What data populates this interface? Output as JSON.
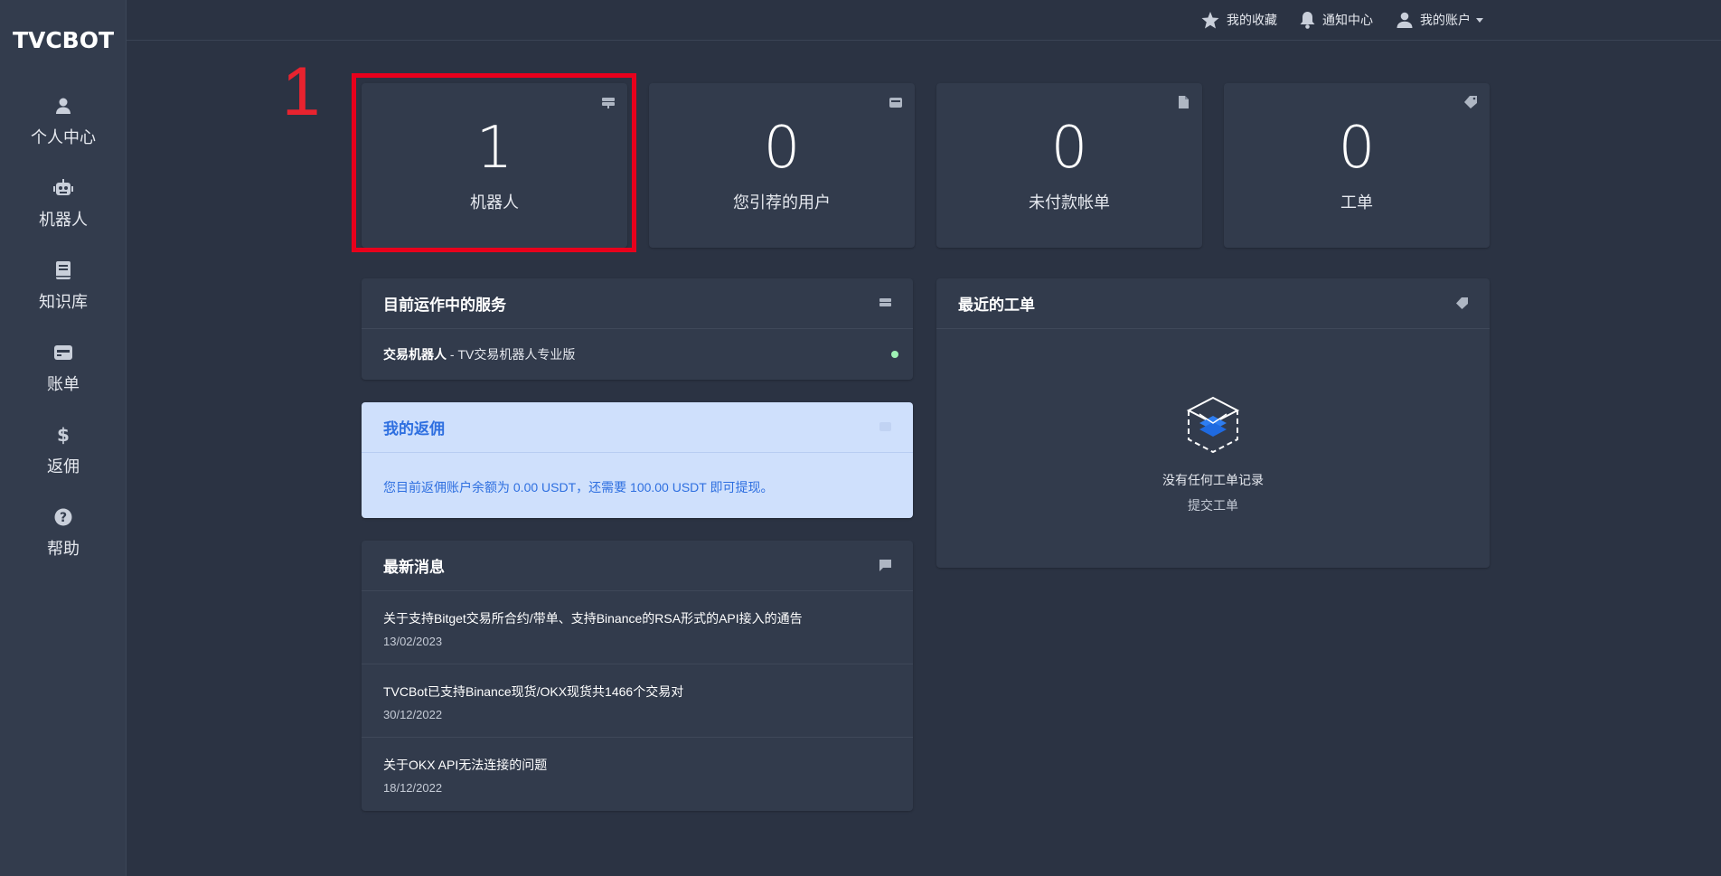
{
  "brand": {
    "logo_text": "TVCBOT"
  },
  "sidebar": {
    "items": [
      {
        "label": "个人中心",
        "icon": "user-icon"
      },
      {
        "label": "机器人",
        "icon": "robot-icon"
      },
      {
        "label": "知识库",
        "icon": "book-icon"
      },
      {
        "label": "账单",
        "icon": "wallet-icon"
      },
      {
        "label": "返佣",
        "icon": "dollar-icon"
      },
      {
        "label": "帮助",
        "icon": "question-icon"
      }
    ]
  },
  "topbar": {
    "favorites": "我的收藏",
    "notifications": "通知中心",
    "account": "我的账户"
  },
  "annotation": {
    "step_number": "1"
  },
  "stats": [
    {
      "value": "1",
      "label": "机器人",
      "icon": "server-icon"
    },
    {
      "value": "0",
      "label": "您引荐的用户",
      "icon": "card-icon"
    },
    {
      "value": "0",
      "label": "未付款帐单",
      "icon": "file-icon"
    },
    {
      "value": "0",
      "label": "工单",
      "icon": "tag-icon"
    }
  ],
  "services": {
    "title": "目前运作中的服务",
    "items": [
      {
        "name": "交易机器人",
        "separator": " - ",
        "plan": "TV交易机器人专业版",
        "status_color": "#9ff2b5"
      }
    ]
  },
  "rebate": {
    "title": "我的返佣",
    "text": "您目前返佣账户余额为 0.00 USDT，还需要 100.00 USDT 即可提现。"
  },
  "news": {
    "title": "最新消息",
    "items": [
      {
        "title": "关于支持Bitget交易所合约/带单、支持Binance的RSA形式的API接入的通告",
        "date": "13/02/2023"
      },
      {
        "title": "TVCBot已支持Binance现货/OKX现货共1466个交易对",
        "date": "30/12/2022"
      },
      {
        "title": "关于OKX API无法连接的问题",
        "date": "18/12/2022"
      }
    ]
  },
  "tickets": {
    "title": "最近的工单",
    "empty_title": "没有任何工单记录",
    "submit_link": "提交工单"
  },
  "colors": {
    "background": "#2b3343",
    "card": "#323b4c",
    "highlight": "#e8001c",
    "accent_blue": "#2e6fe0",
    "rebate_bg": "#cfe0fc"
  }
}
